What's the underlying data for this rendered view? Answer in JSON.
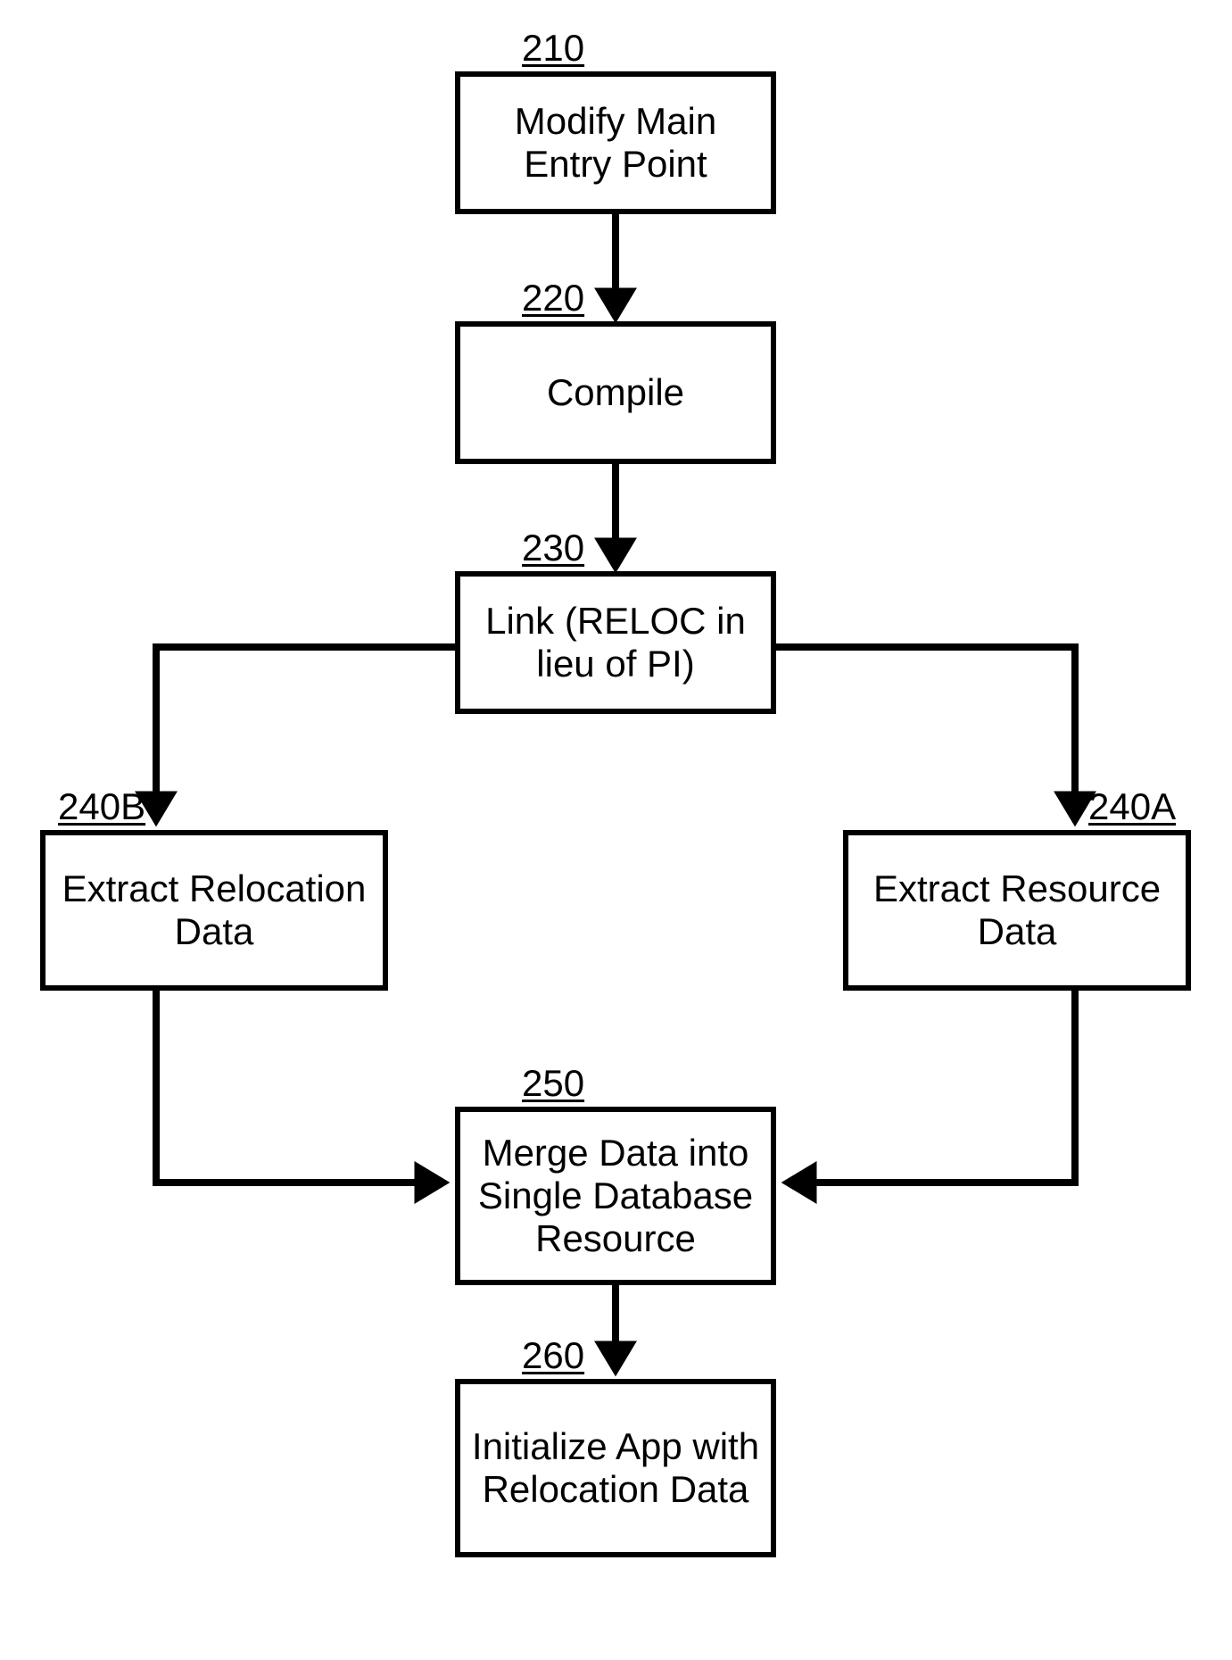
{
  "nodes": {
    "n210": {
      "id": "210",
      "text": "Modify Main Entry Point"
    },
    "n220": {
      "id": "220",
      "text": "Compile"
    },
    "n230": {
      "id": "230",
      "text": "Link (RELOC in lieu of PI)"
    },
    "n240B": {
      "id": "240B",
      "text": "Extract Relocation Data"
    },
    "n240A": {
      "id": "240A",
      "text": "Extract Resource Data"
    },
    "n250": {
      "id": "250",
      "text": "Merge Data into Single Database Resource"
    },
    "n260": {
      "id": "260",
      "text": "Initialize  App with Relocation Data"
    }
  }
}
